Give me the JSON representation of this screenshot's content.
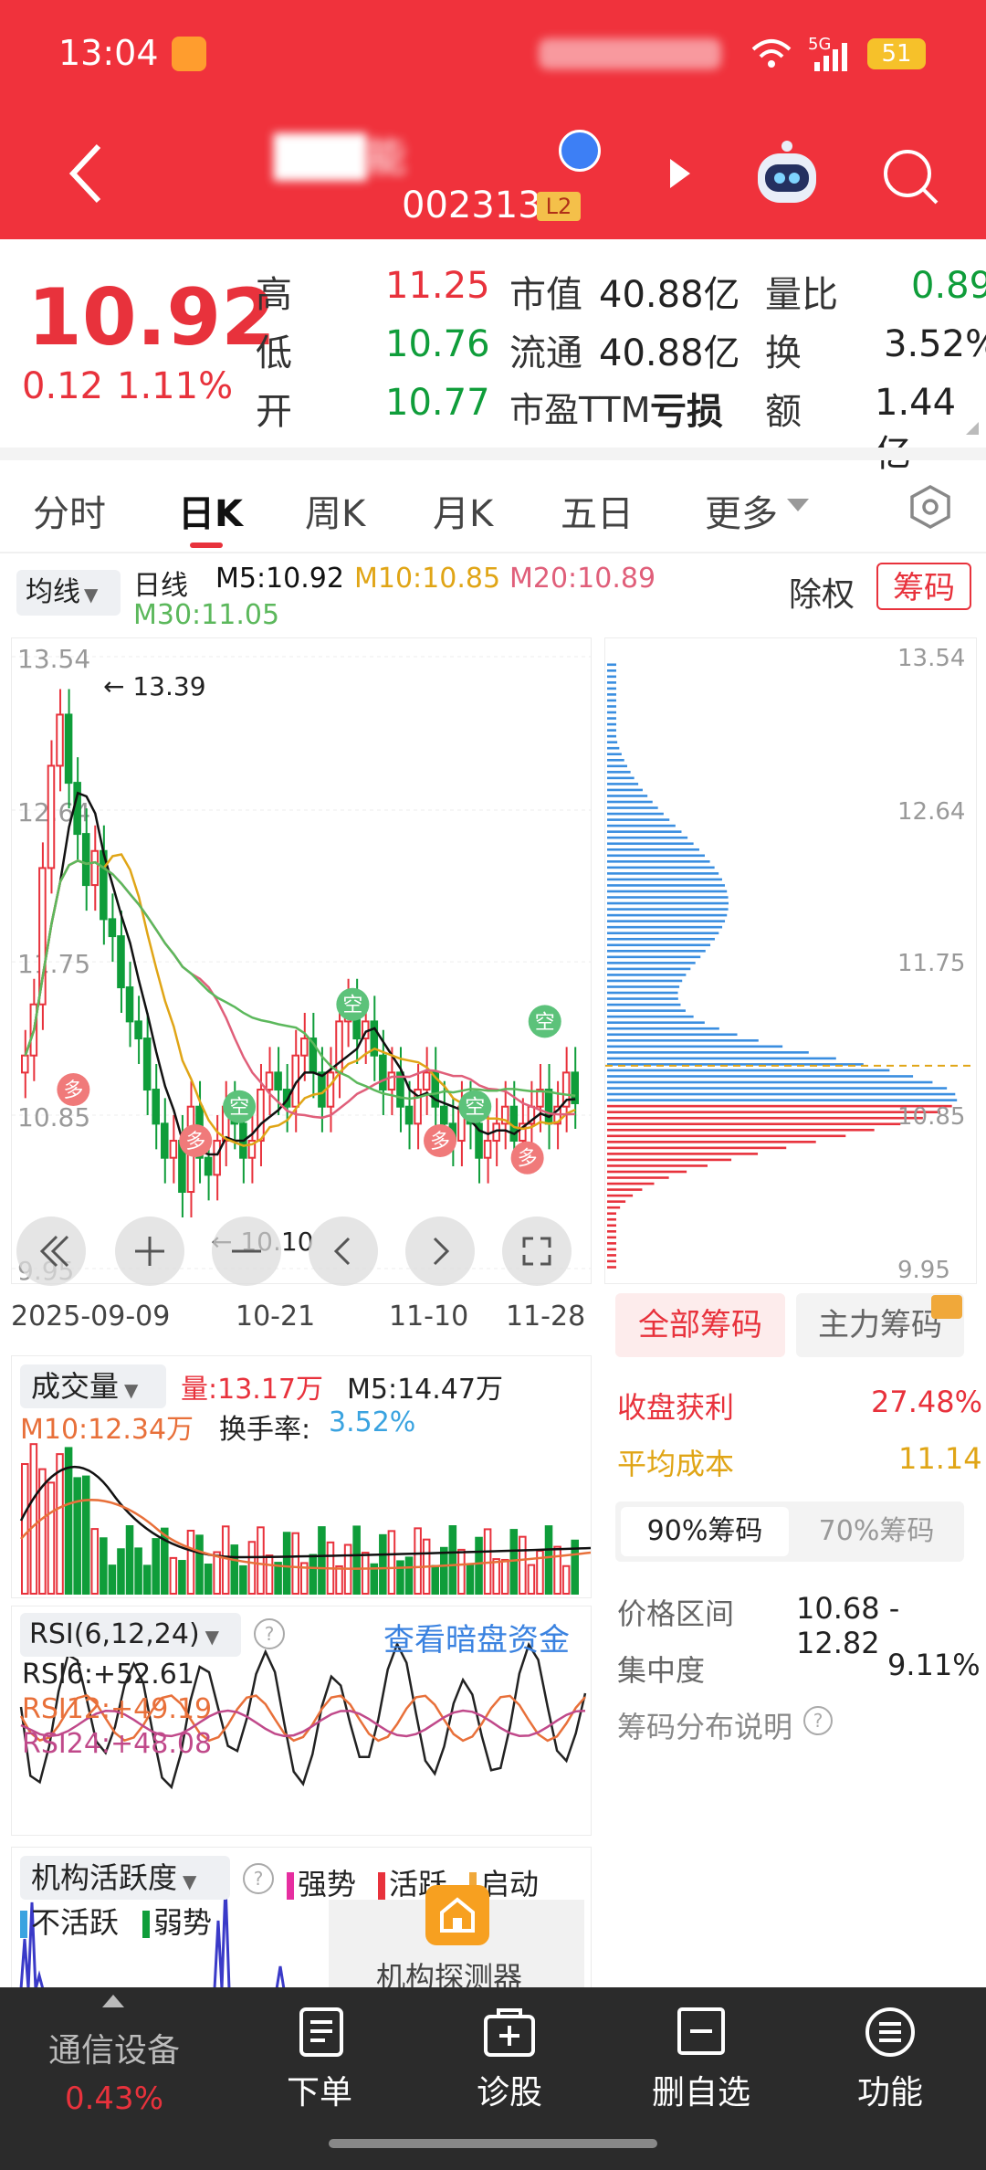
{
  "status_bar": {
    "time": "13:04",
    "net_unit": "k/s",
    "signal": "5G",
    "battery": "51"
  },
  "header": {
    "stock_name": "███能",
    "stock_code": "002313",
    "level_badge": "L2"
  },
  "quote": {
    "price": "10.92",
    "change": "0.12",
    "change_pct": "1.11%",
    "high_label": "高",
    "high": "11.25",
    "low_label": "低",
    "low": "10.76",
    "open_label": "开",
    "open": "10.77",
    "mktcap_label": "市值",
    "mktcap": "40.88亿",
    "float_label": "流通",
    "float_cap": "40.88亿",
    "pe_label": "市盈TTM",
    "pe": "亏损",
    "vol_ratio_label": "量比",
    "vol_ratio": "0.89",
    "turnover_label": "换",
    "turnover": "3.52%",
    "amount_label": "额",
    "amount": "1.44亿"
  },
  "tabs": [
    {
      "label": "分时"
    },
    {
      "label": "日K"
    },
    {
      "label": "周K"
    },
    {
      "label": "月K"
    },
    {
      "label": "五日"
    },
    {
      "label": "更多"
    }
  ],
  "kline": {
    "ma_button": "均线",
    "period": "日线",
    "m5": "M5:10.92",
    "m10": "M10:10.85",
    "m20": "M20:10.89",
    "m30": "M30:11.05",
    "adjust": "除权",
    "chips_btn": "筹码",
    "high_mark": "13.39",
    "low_mark": "10.10",
    "y_ticks": [
      "13.54",
      "12.64",
      "11.75",
      "10.85",
      "9.95"
    ],
    "x_ticks": [
      "2025-09-09",
      "10-21",
      "11-10",
      "11-28"
    ],
    "signal_duo": "多",
    "signal_kong": "空",
    "colors": {
      "up": "#e8323c",
      "down": "#0f9d3a",
      "m5": "#111111",
      "m10": "#e0a516",
      "m20": "#e05f7a",
      "m30": "#5cb85c"
    }
  },
  "chips": {
    "tab_all": "全部筹码",
    "tab_main": "主力筹码",
    "y_ticks": [
      "13.54",
      "12.64",
      "11.75",
      "10.85",
      "9.95"
    ],
    "profit_label": "收盘获利",
    "profit": "27.48%",
    "avgcost_label": "平均成本",
    "avgcost": "11.14",
    "sub_90": "90%筹码",
    "sub_70": "70%筹码",
    "range_label": "价格区间",
    "range": "10.68 - 12.82",
    "conc_label": "集中度",
    "conc": "9.11%",
    "help": "筹码分布说明"
  },
  "volume": {
    "title": "成交量",
    "vol": "量:13.17万",
    "m5": "M5:14.47万",
    "m10": "M10:12.34万",
    "turnover_label": "换手率:",
    "turnover": "3.52%"
  },
  "rsi": {
    "title": "RSI(6,12,24)",
    "link": "查看暗盘资金",
    "rsi6": "RSI6:+52.61",
    "rsi12": "RSI12:+49.19",
    "rsi24": "RSI24:+48.08"
  },
  "inst": {
    "title": "机构活跃度",
    "strong": "强势",
    "active": "活跃",
    "start": "启动",
    "inactive": "不活跃",
    "weak": "弱势",
    "detector": "机构探测器"
  },
  "bottom_nav": {
    "sector": "通信设备",
    "sector_pct": "0.43%",
    "order": "下单",
    "diagnose": "诊股",
    "remove": "删自选",
    "func": "功能"
  }
}
